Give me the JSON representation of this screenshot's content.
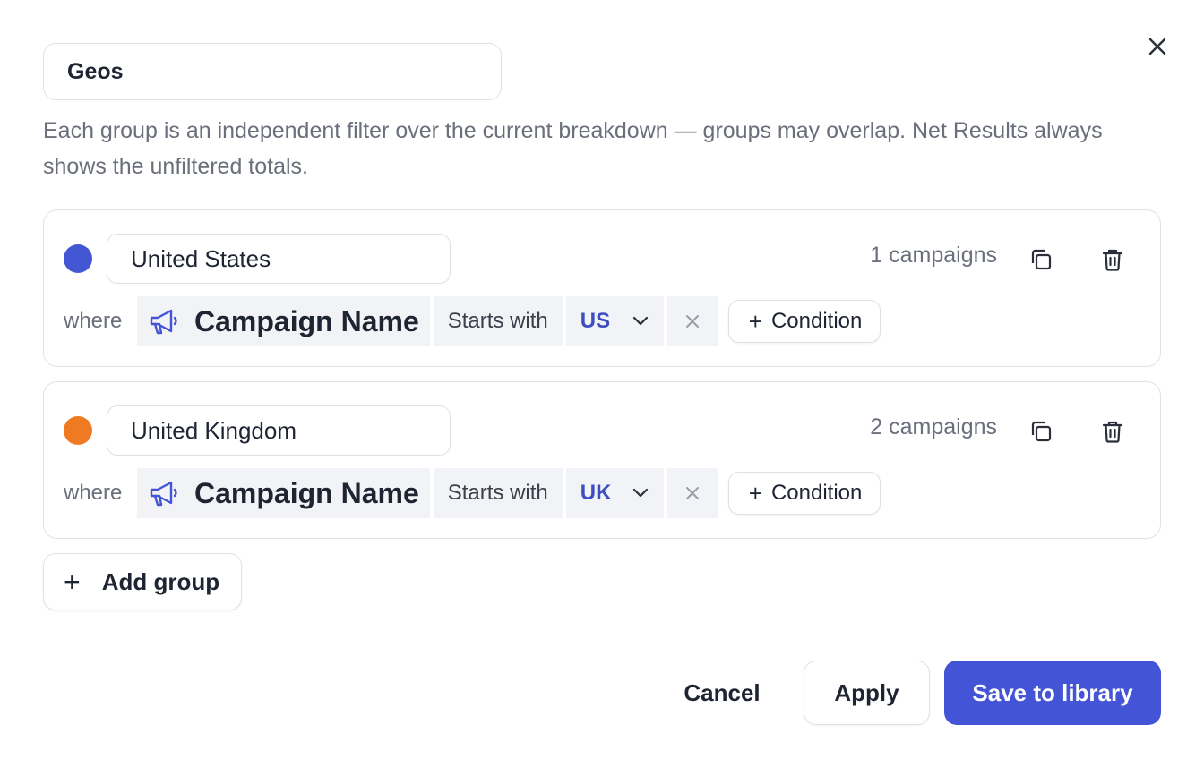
{
  "header": {
    "title_value": "Geos",
    "close_icon": "close-icon"
  },
  "description": "Each group is an independent filter over the current breakdown — groups may overlap. Net Results always shows the unfiltered totals.",
  "groups": [
    {
      "color": "#4356d4",
      "name": "United States",
      "count": "1 campaigns",
      "where": "where",
      "field": "Campaign Name",
      "operator": "Starts with",
      "value": "US",
      "add_condition": "Condition"
    },
    {
      "color": "#ef7a22",
      "name": "United Kingdom",
      "count": "2 campaigns",
      "where": "where",
      "field": "Campaign Name",
      "operator": "Starts with",
      "value": "UK",
      "add_condition": "Condition"
    }
  ],
  "add_group_label": "Add group",
  "footer": {
    "cancel_label": "Cancel",
    "apply_label": "Apply",
    "save_label": "Save to library"
  },
  "colors": {
    "accent": "#4355d6",
    "value_text": "#3d4ec0",
    "muted_text": "#6a6f7b"
  }
}
